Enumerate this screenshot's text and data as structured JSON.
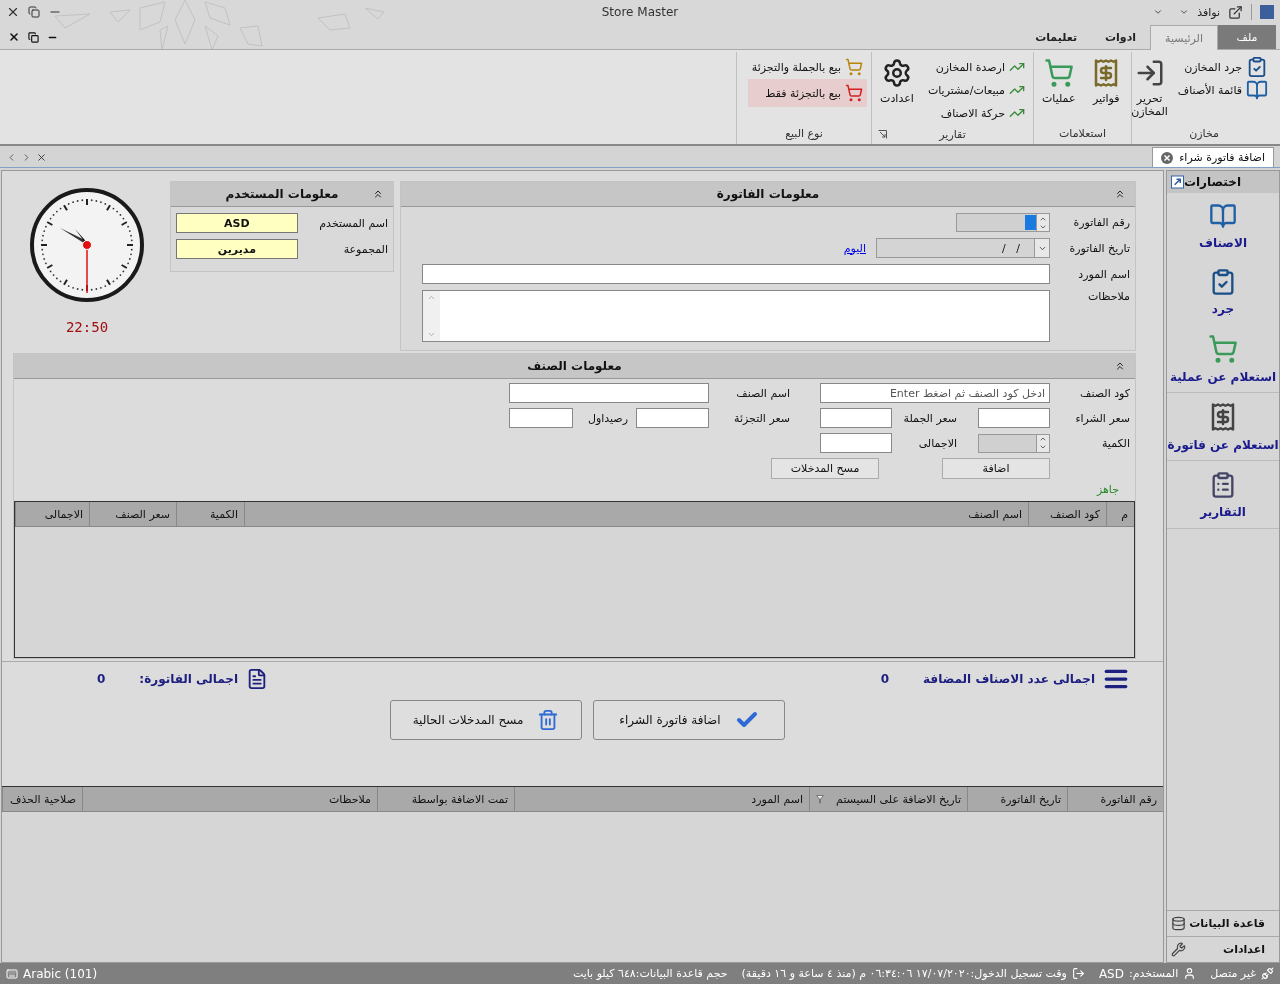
{
  "title_bar": {
    "title": "Store Master",
    "windows_menu": "نوافذ"
  },
  "ribbon_tabs": [
    {
      "label": "ملف",
      "kind": "file",
      "selected": false
    },
    {
      "label": "الرئيسية",
      "kind": "tab",
      "selected": true
    },
    {
      "label": "ادوات",
      "kind": "tab",
      "selected": false
    },
    {
      "label": "تعليمات",
      "kind": "tab",
      "selected": false
    }
  ],
  "ribbon_groups": [
    {
      "title": "مخازن",
      "launcher": false,
      "items": [
        {
          "label": "جرد المخازن",
          "kind": "small",
          "selected": false
        },
        {
          "label": "قائمة الأصناف",
          "kind": "small",
          "selected": false
        },
        {
          "label": "تحرير المخازن",
          "kind": "large",
          "selected": false
        }
      ]
    },
    {
      "title": "استعلامات",
      "launcher": false,
      "items": [
        {
          "label": "فواتير",
          "kind": "large",
          "selected": false
        },
        {
          "label": "عمليات",
          "kind": "large",
          "selected": false
        }
      ]
    },
    {
      "title": "تقارير",
      "launcher": true,
      "items": [
        {
          "label": "ارصدة المخازن",
          "kind": "small",
          "selected": false
        },
        {
          "label": "مبيعات/مشتريات",
          "kind": "small",
          "selected": false
        },
        {
          "label": "حركة الاصناف",
          "kind": "small",
          "selected": false
        },
        {
          "label": "اعدادت",
          "kind": "large",
          "selected": false
        }
      ]
    },
    {
      "title": "نوع البيع",
      "launcher": false,
      "items": [
        {
          "label": "بيع بالجملة والتجزئة",
          "kind": "small",
          "selected": false
        },
        {
          "label": "بيع بالتجزئة فقط",
          "kind": "small",
          "selected": true
        }
      ]
    }
  ],
  "document_tabs": [
    {
      "label": "اضافة فاتورة شراء",
      "selected": true
    }
  ],
  "invoice_panel": {
    "title": "معلومات الفاتورة",
    "number_label": "رقم الفاتورة",
    "date_label": "تاريخ الفاتورة",
    "date_value": "/   /",
    "today_link": "اليوم",
    "supplier_label": "اسم المورد",
    "notes_label": "ملاحظات"
  },
  "user_panel": {
    "title": "معلومات المستخدم",
    "fields": [
      {
        "label": "اسم المستخدم",
        "value": "ASD"
      },
      {
        "label": "المجموعة",
        "value": "مديرين"
      }
    ]
  },
  "clock": {
    "time": "22:50"
  },
  "item_panel": {
    "title": "معلومات الصنف",
    "code_label": "كود الصنف",
    "code_placeholder": "ادخل كود الصنف ثم اضغط Enter",
    "name_label": "اسم الصنف",
    "purchase_label": "سعر الشراء",
    "wholesale_label": "سعر الجملة",
    "retail_label": "سعر التجزئة",
    "opening_label": "رصيداول",
    "quantity_label": "الكمية",
    "total_label": "الاجمالى",
    "add_button": "اضافة",
    "clear_button": "مسح المدخلات",
    "status": "جاهز"
  },
  "items_table": {
    "columns": [
      "م",
      "كود الصنف",
      "اسم الصنف",
      "الكمية",
      "سعر الصنف",
      "الاجمالى"
    ]
  },
  "summary": {
    "count_label": "اجمالى عدد الاصناف المضافة",
    "count_value": "0",
    "total_label": "اجمالى الفاتورة:",
    "total_value": "0"
  },
  "actions": [
    "اضافة فاتورة الشراء",
    "مسح المدخلات الحالية"
  ],
  "invoices_table": {
    "columns": [
      "رقم الفاتورة",
      "تاريخ الفاتورة",
      "تاريخ الاضافة على السيستم",
      "اسم المورد",
      "تمت الاضافة بواسطة",
      "ملاحظات",
      "صلاحية الحذف"
    ]
  },
  "sidebar": {
    "title": "اختصارات",
    "items": [
      "الاصناف",
      "جرد",
      "استعلام عن عملية",
      "استعلام عن فاتورة",
      "التقارير"
    ],
    "footer": [
      "قاعدة البيانات",
      "اعدادات"
    ]
  },
  "status_bar": {
    "connection": "غير متصل",
    "user_label": "المستخدم:",
    "user": "ASD",
    "login": "وقت تسجيل الدخول:١٧/٠٧/٢٠٢٠ ٠٦:٣٤:٠٦ م (منذ ٤ ساعة و ١٦ دقيقة)",
    "db_size": "حجم قاعدة البيانات:٦٤٨ كيلو بايت",
    "keyboard": "Arabic (101)"
  }
}
